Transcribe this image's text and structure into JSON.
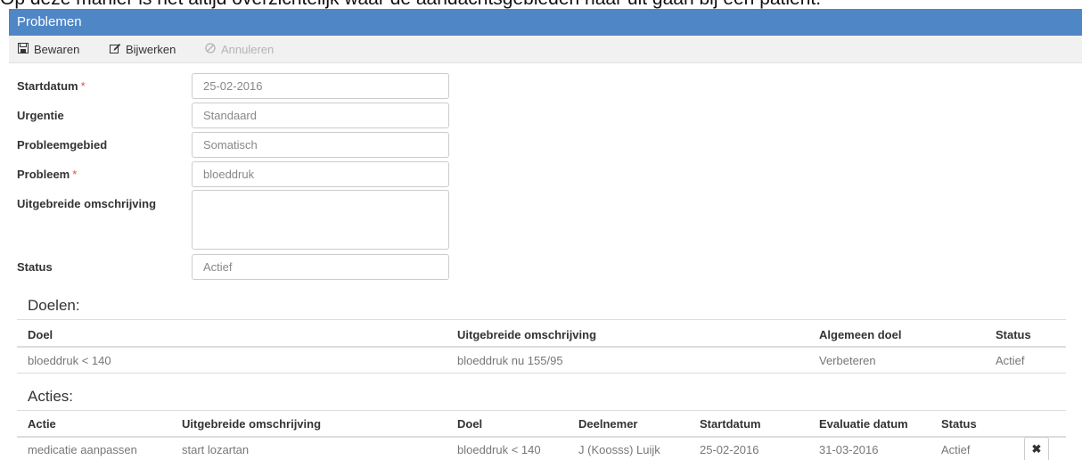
{
  "caption": "Op deze manier is het altijd overzichtelijk waar de aandachtsgebieden naar uit gaan bij een patiënt.",
  "panel": {
    "title": "Problemen"
  },
  "toolbar": {
    "save_label": "Bewaren",
    "update_label": "Bijwerken",
    "cancel_label": "Annuleren"
  },
  "form": {
    "startdatum_label": "Startdatum",
    "startdatum_value": "25-02-2016",
    "urgentie_label": "Urgentie",
    "urgentie_value": "Standaard",
    "probleemgebied_label": "Probleemgebied",
    "probleemgebied_value": "Somatisch",
    "probleem_label": "Probleem",
    "probleem_value": "bloeddruk",
    "omschrijving_label": "Uitgebreide omschrijving",
    "omschrijving_value": "",
    "status_label": "Status",
    "status_value": "Actief",
    "required_marker": "*"
  },
  "doelen": {
    "title": "Doelen:",
    "headers": [
      "Doel",
      "Uitgebreide omschrijving",
      "Algemeen doel",
      "Status"
    ],
    "rows": [
      [
        "bloeddruk < 140",
        "bloeddruk nu 155/95",
        "Verbeteren",
        "Actief"
      ]
    ]
  },
  "acties": {
    "title": "Acties:",
    "headers": [
      "Actie",
      "Uitgebreide omschrijving",
      "Doel",
      "Deelnemer",
      "Startdatum",
      "Evaluatie datum",
      "Status"
    ],
    "rows": [
      [
        "medicatie aanpassen",
        "start lozartan",
        "bloeddruk < 140",
        "J (Koosss) Luijk",
        "25-02-2016",
        "31-03-2016",
        "Actief"
      ]
    ],
    "delete_glyph": "✖"
  },
  "icons": {
    "save": "save-icon",
    "edit": "edit-icon",
    "cancel": "cancel-icon",
    "delete": "delete-icon"
  },
  "colors": {
    "header_bg": "#4f86c6",
    "toolbar_bg": "#f1f1f1",
    "required": "#d9534f"
  }
}
